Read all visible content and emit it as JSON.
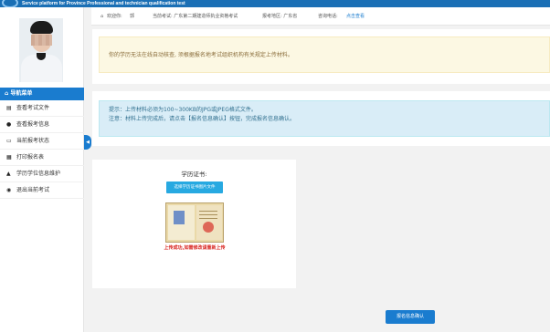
{
  "brand": {
    "subtitle": "Service platform for Province Professional and technician qualification test"
  },
  "infobar": {
    "welcome": "欢迎你:",
    "user": "郭",
    "exam": "当前考试: 广东第二期建造师执业资格考试",
    "region": "报考地区: 广东省",
    "phone_label": "咨询电话:",
    "phone_link": "点击查看"
  },
  "sidebar": {
    "header": "导航菜单",
    "items": [
      {
        "icon": "file-icon",
        "glyph": "▤",
        "label": "查看考试文件"
      },
      {
        "icon": "info-icon",
        "glyph": "●",
        "label": "查看报考信息"
      },
      {
        "icon": "monitor-icon",
        "glyph": "▭",
        "label": "当前报考状态"
      },
      {
        "icon": "print-icon",
        "glyph": "▦",
        "label": "打印报名表"
      },
      {
        "icon": "graduation-cap-icon",
        "glyph": "▲",
        "label": "学历学位信息维护"
      },
      {
        "icon": "logout-icon",
        "glyph": "◉",
        "label": "退出当前考试"
      }
    ],
    "collapse_glyph": "◀"
  },
  "warning": "你的学历无法在线自动核查, 须根据报名地考试组织机构有关规定上传材料。",
  "tips": {
    "line1": "提示：上传材料必须为100~300KB的JPG或JPEG格式文件。",
    "line2": "注意：材料上传完成后，请点击【报名信息确认】按钮，完成报名信息确认。"
  },
  "certificate": {
    "title": "学历证书:",
    "choose_button": "选择学历证书图片文件",
    "upload_status": "上传成功,如需修改请重新上传"
  },
  "confirm_button": "报名信息确认",
  "colors": {
    "primary": "#1a7ccf",
    "warning_bg": "#fcf8e3",
    "info_bg": "#d9edf7",
    "error": "#d8221e"
  }
}
